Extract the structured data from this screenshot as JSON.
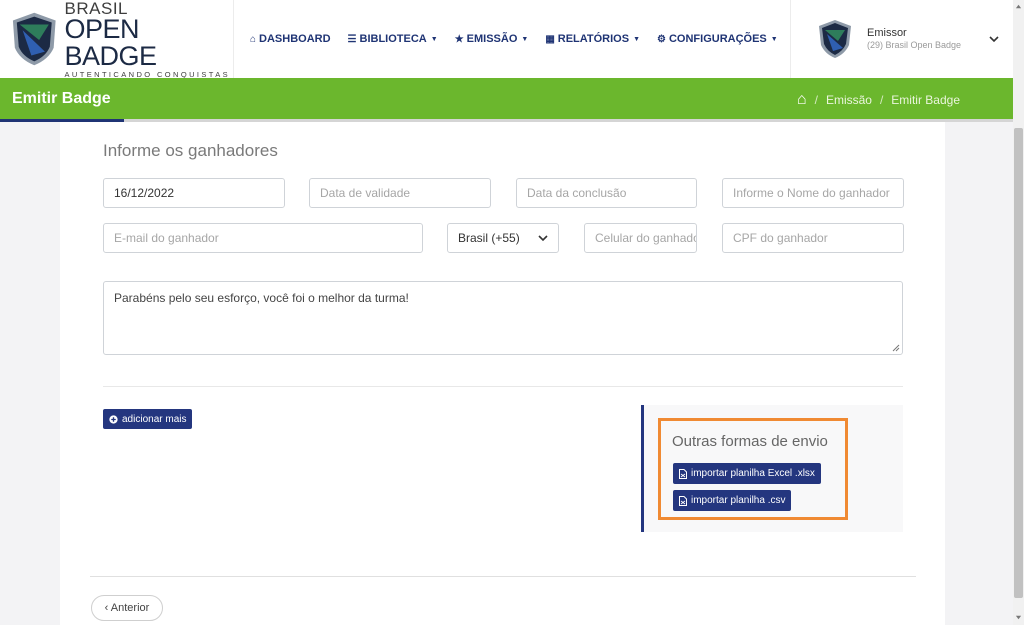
{
  "brand": {
    "line1": "BRASIL",
    "line2": "OPEN BADGE",
    "tagline": "AUTENTICANDO CONQUISTAS"
  },
  "nav": {
    "items": [
      {
        "label": "DASHBOARD",
        "icon": "home-icon",
        "has_dropdown": false
      },
      {
        "label": "BIBLIOTECA",
        "icon": "database-icon",
        "has_dropdown": true
      },
      {
        "label": "EMISSÃO",
        "icon": "trophy-icon",
        "has_dropdown": true
      },
      {
        "label": "RELATÓRIOS",
        "icon": "book-icon",
        "has_dropdown": true
      },
      {
        "label": "CONFIGURAÇÕES",
        "icon": "gears-icon",
        "has_dropdown": true
      }
    ]
  },
  "user": {
    "role": "Emissor",
    "org": "(29) Brasil Open Badge"
  },
  "page": {
    "title": "Emitir Badge",
    "breadcrumb": [
      "Emissão",
      "Emitir Badge"
    ]
  },
  "form": {
    "section_title": "Informe os ganhadores",
    "issue_date": {
      "value": "16/12/2022"
    },
    "validity_date": {
      "placeholder": "Data de validade"
    },
    "completion_date": {
      "placeholder": "Data da conclusão"
    },
    "winner_name": {
      "placeholder": "Informe o Nome do ganhador"
    },
    "winner_email": {
      "placeholder": "E-mail do ganhador"
    },
    "country_code": {
      "value": "Brasil (+55)"
    },
    "winner_phone": {
      "placeholder": "Celular do ganhador"
    },
    "winner_cpf": {
      "placeholder": "CPF do ganhador"
    },
    "message": {
      "value": "Parabéns pelo seu esforço, você foi o melhor da turma!"
    },
    "add_more_label": "adicionar mais"
  },
  "other_methods": {
    "title": "Outras formas de envio",
    "import_excel_label": "importar planilha Excel .xlsx",
    "import_csv_label": "importar planilha .csv"
  },
  "footer": {
    "previous_label": "‹ Anterior"
  },
  "colors": {
    "nav_blue": "#1f3474",
    "green_bar": "#6bb72d",
    "button_blue": "#24367f",
    "highlight_orange": "#f08a33"
  }
}
